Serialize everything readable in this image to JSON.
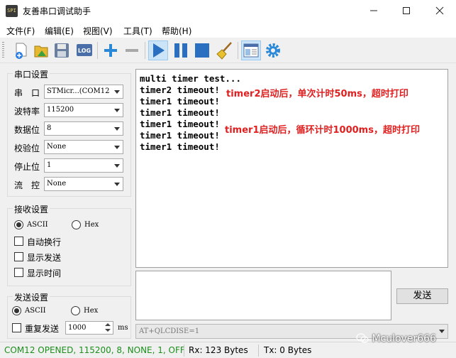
{
  "window": {
    "title": "友善串口调试助手",
    "icon_text": "SPI",
    "controls": [
      "minimize-icon",
      "maximize-icon",
      "close-icon"
    ]
  },
  "menu": [
    "文件(F)",
    "编辑(E)",
    "视图(V)",
    "工具(T)",
    "帮助(H)"
  ],
  "toolbar": {
    "icons": [
      "new-icon",
      "open-icon",
      "save-icon",
      "log-icon",
      "plus-icon",
      "minus-icon",
      "play-icon",
      "pause-icon",
      "stop-icon",
      "clear-broom-icon",
      "window-icon",
      "settings-gear-icon"
    ],
    "log_label": "LOG",
    "active": [
      "play-icon",
      "window-icon"
    ]
  },
  "serial": {
    "group_label": "串口设置",
    "fields": [
      {
        "label": "串　口",
        "value": "STMicr...(COM12"
      },
      {
        "label": "波特率",
        "value": "115200"
      },
      {
        "label": "数据位",
        "value": "8"
      },
      {
        "label": "校验位",
        "value": "None"
      },
      {
        "label": "停止位",
        "value": "1"
      },
      {
        "label": "流　控",
        "value": "None"
      }
    ]
  },
  "receive": {
    "group_label": "接收设置",
    "ascii_label": "ASCII",
    "hex_label": "Hex",
    "selected_format": "ASCII",
    "options": [
      {
        "label": "自动换行",
        "checked": false
      },
      {
        "label": "显示发送",
        "checked": false
      },
      {
        "label": "显示时间",
        "checked": false
      }
    ]
  },
  "send": {
    "group_label": "发送设置",
    "ascii_label": "ASCII",
    "hex_label": "Hex",
    "selected_format": "ASCII",
    "repeat_label": "重复发送",
    "repeat_checked": false,
    "interval_value": "1000",
    "interval_unit": "ms",
    "button_label": "发送",
    "input_value": "",
    "command_value": "AT+QLCDISE=1"
  },
  "rx_lines": [
    "multi timer test...",
    "timer2 timeout!",
    "timer1 timeout!",
    "timer1 timeout!",
    "timer1 timeout!",
    "timer1 timeout!",
    "timer1 timeout!"
  ],
  "annotations": [
    "timer2启动后，单次计时50ms，超时打印",
    "timer1启动后，循环计时1000ms，超时打印"
  ],
  "annotation_color": "#e02020",
  "status": {
    "connection": "COM12 OPENED, 115200, 8, NONE, 1, OFF",
    "connection_color": "#1a8f1a",
    "rx": "Rx: 123 Bytes",
    "tx": "Tx: 0 Bytes"
  },
  "watermark": "Mculover666"
}
